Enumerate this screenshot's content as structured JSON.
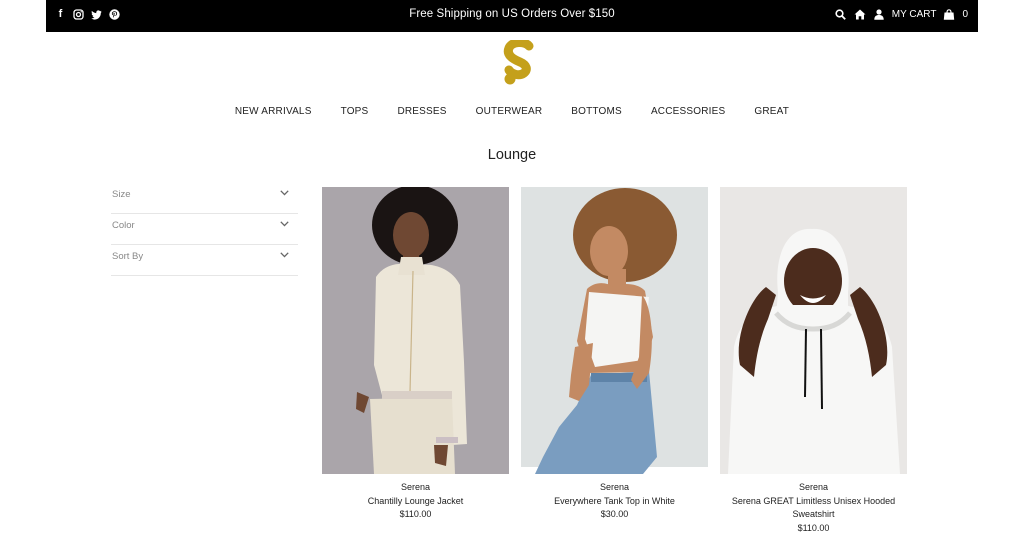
{
  "topbar": {
    "social_icons": [
      "facebook-icon",
      "instagram-icon",
      "twitter-icon",
      "pinterest-icon"
    ],
    "promo_text": "Free Shipping on US Orders Over $150",
    "utility_icons": [
      "search-icon",
      "home-icon",
      "user-icon"
    ],
    "cart_label": "MY CART",
    "cart_count": "0"
  },
  "brand": {
    "accent_color": "#c4a01b"
  },
  "nav": {
    "items": [
      "NEW ARRIVALS",
      "TOPS",
      "DRESSES",
      "OUTERWEAR",
      "BOTTOMS",
      "ACCESSORIES",
      "GREAT"
    ]
  },
  "page": {
    "title": "Lounge"
  },
  "filters": [
    "Size",
    "Color",
    "Sort By"
  ],
  "products": [
    {
      "brand": "Serena",
      "name": "Chantilly Lounge Jacket",
      "price": "$110.00"
    },
    {
      "brand": "Serena",
      "name": "Everywhere Tank Top in White",
      "price": "$30.00"
    },
    {
      "brand": "Serena",
      "name": "Serena GREAT Limitless Unisex Hooded Sweatshirt",
      "price": "$110.00"
    }
  ]
}
